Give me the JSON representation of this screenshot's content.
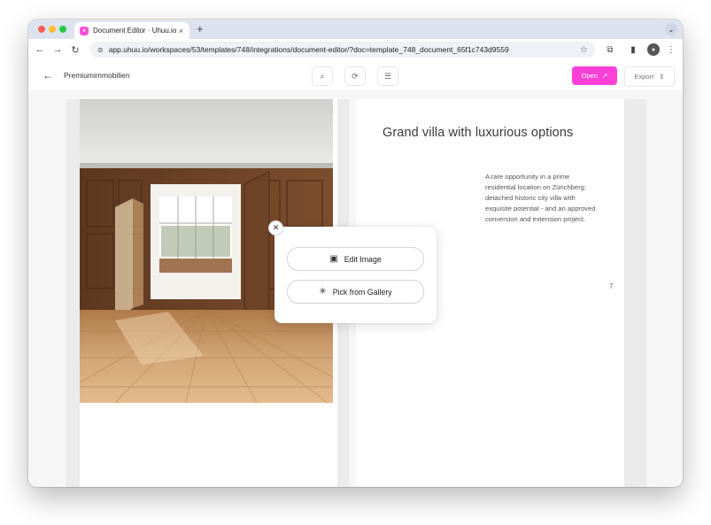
{
  "browser": {
    "tab_title": "Document Editor · Uhuu.io",
    "tab_close": "×",
    "new_tab": "+",
    "url": "app.uhuu.io/workspaces/53/templates/748/integrations/document-editor/?doc=template_748_document_65f1c743d9559"
  },
  "header": {
    "doc_title": "Premiumimmobilien",
    "open_label": "Open",
    "export_label": "Export"
  },
  "page": {
    "headline": "Grand villa with luxurious options",
    "body": "A rare opportunity in a prime residential location on Zürichberg: detached historic city villa with exquisite potential - and an approved conversion and extension project.",
    "page_number": "7"
  },
  "popup": {
    "edit_image_label": "Edit Image",
    "pick_gallery_label": "Pick from Gallery"
  },
  "icons": {
    "favicon": "uhuu-logo-icon",
    "back": "arrow-left-icon",
    "zoom": "zoom-icon",
    "refresh": "refresh-icon",
    "settings": "sliders-icon",
    "image": "image-icon",
    "sparkle": "sparkle-icon"
  },
  "colors": {
    "accent": "#ff40d6",
    "tabstrip": "#dde3ee"
  }
}
